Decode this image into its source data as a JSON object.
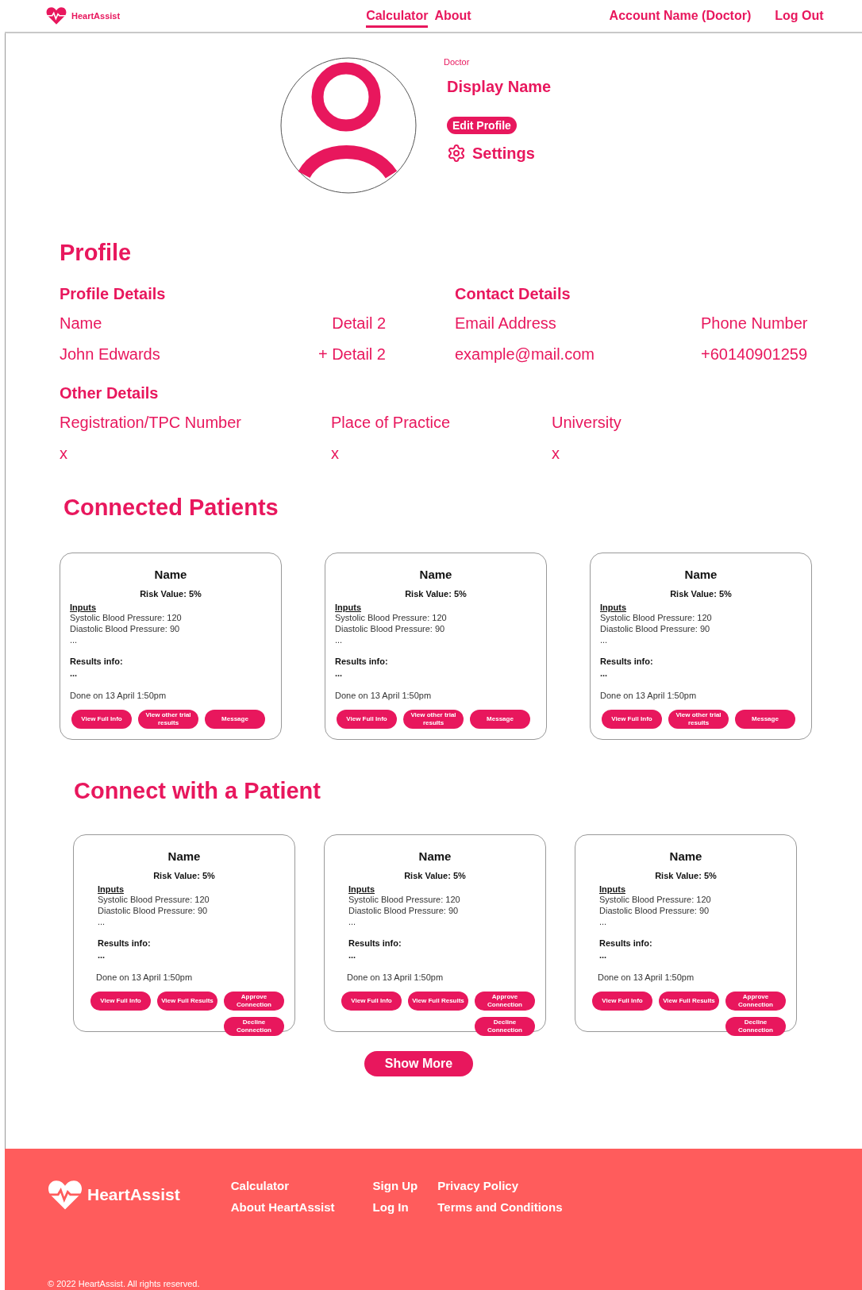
{
  "header": {
    "logo": "HeartAssist",
    "nav": [
      {
        "label": "Calculator",
        "selected": true
      },
      {
        "label": "About",
        "selected": false
      }
    ],
    "account": "Account Name (Doctor)",
    "logout": "Log Out"
  },
  "profile_header": {
    "role": "Doctor",
    "display_name": "Display Name",
    "edit_button": "Edit Profile",
    "settings": "Settings"
  },
  "profile": {
    "title": "Profile",
    "profile_details": {
      "title": "Profile Details",
      "fields": [
        {
          "label": "Name",
          "value": "John Edwards"
        },
        {
          "label": "Detail 2",
          "value": "+ Detail 2"
        }
      ]
    },
    "contact_details": {
      "title": "Contact Details",
      "fields": [
        {
          "label": "Email Address",
          "value": "example@mail.com"
        },
        {
          "label": "Phone Number",
          "value": "+60140901259"
        }
      ]
    },
    "other_details": {
      "title": "Other Details",
      "fields": [
        {
          "label": "Registration/TPC Number",
          "value": "x"
        },
        {
          "label": "Place of Practice",
          "value": "x"
        },
        {
          "label": "University",
          "value": "x"
        }
      ]
    }
  },
  "connected_patients": {
    "title": "Connected Patients",
    "cards": [
      {
        "name": "Name",
        "risk": "Risk Value: 5%",
        "inputs_title": "Inputs",
        "inputs": [
          "Systolic Blood Pressure: 120",
          "Diastolic Blood Pressure: 90",
          "..."
        ],
        "results_title": "Results info:",
        "results": "...",
        "done": "Done on 13 April 1:50pm",
        "buttons": [
          "View Full Info",
          "View other trial results",
          "Message"
        ]
      },
      {
        "name": "Name",
        "risk": "Risk Value: 5%",
        "inputs_title": "Inputs",
        "inputs": [
          "Systolic Blood Pressure: 120",
          "Diastolic Blood Pressure: 90",
          "..."
        ],
        "results_title": "Results info:",
        "results": "...",
        "done": "Done on 13 April 1:50pm",
        "buttons": [
          "View Full Info",
          "View other trial results",
          "Message"
        ]
      },
      {
        "name": "Name",
        "risk": "Risk Value: 5%",
        "inputs_title": "Inputs",
        "inputs": [
          "Systolic Blood Pressure: 120",
          "Diastolic Blood Pressure: 90",
          "..."
        ],
        "results_title": "Results info:",
        "results": "...",
        "done": "Done on 13 April 1:50pm",
        "buttons": [
          "View Full Info",
          "View other trial results",
          "Message"
        ]
      }
    ]
  },
  "connect_patient": {
    "title": "Connect with a Patient",
    "cards": [
      {
        "name": "Name",
        "risk": "Risk Value: 5%",
        "inputs_title": "Inputs",
        "inputs": [
          "Systolic Blood Pressure: 120",
          "Diastolic Blood Pressure: 90",
          "..."
        ],
        "results_title": "Results info:",
        "results": "...",
        "done": "Done on 13 April 1:50pm",
        "buttons": [
          "View Full Info",
          "View Full Results",
          "Approve Connection",
          "Decline  Connection"
        ]
      },
      {
        "name": "Name",
        "risk": "Risk Value: 5%",
        "inputs_title": "Inputs",
        "inputs": [
          "Systolic Blood Pressure: 120",
          "Diastolic Blood Pressure: 90",
          "..."
        ],
        "results_title": "Results info:",
        "results": "...",
        "done": "Done on 13 April 1:50pm",
        "buttons": [
          "View Full Info",
          "View Full Results",
          "Approve Connection",
          "Decline  Connection"
        ]
      },
      {
        "name": "Name",
        "risk": "Risk Value: 5%",
        "inputs_title": "Inputs",
        "inputs": [
          "Systolic Blood Pressure: 120",
          "Diastolic Blood Pressure: 90",
          "..."
        ],
        "results_title": "Results info:",
        "results": "...",
        "done": "Done on 13 April 1:50pm",
        "buttons": [
          "View Full Info",
          "View Full Results",
          "Approve Connection",
          "Decline  Connection"
        ]
      }
    ],
    "show_more": "Show More"
  },
  "footer": {
    "logo": "HeartAssist",
    "link_columns": [
      [
        "Calculator",
        "About HeartAssist"
      ],
      [
        "Sign Up",
        "Log In"
      ],
      [
        "Privacy Policy",
        "Terms and Conditions"
      ]
    ],
    "copyright": "© 2022 HeartAssist. All rights reserved."
  }
}
